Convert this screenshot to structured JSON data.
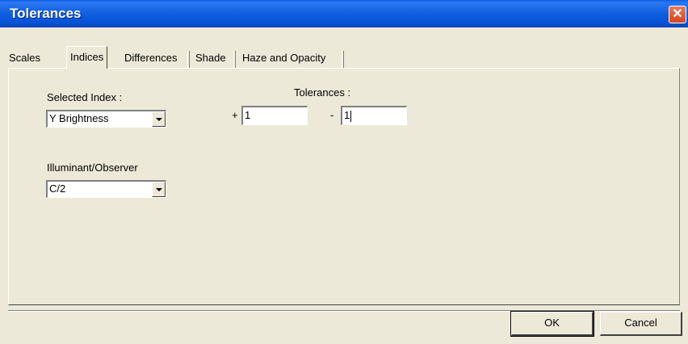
{
  "window": {
    "title": "Tolerances",
    "close_symbol": "✕"
  },
  "tabs": [
    {
      "label": "Scales",
      "active": false
    },
    {
      "label": "Indices",
      "active": true
    },
    {
      "label": "Differences",
      "active": false
    },
    {
      "label": "Shade",
      "active": false
    },
    {
      "label": "Haze and Opacity",
      "active": false
    }
  ],
  "form": {
    "selected_index_label": "Selected Index :",
    "selected_index_value": "Y Brightness",
    "illuminant_label": "Illuminant/Observer",
    "illuminant_value": "C/2",
    "tolerances_label": "Tolerances :",
    "plus_sign": "+",
    "plus_value": "1",
    "minus_sign": "-",
    "minus_value": "1"
  },
  "buttons": {
    "ok": "OK",
    "cancel": "Cancel"
  }
}
